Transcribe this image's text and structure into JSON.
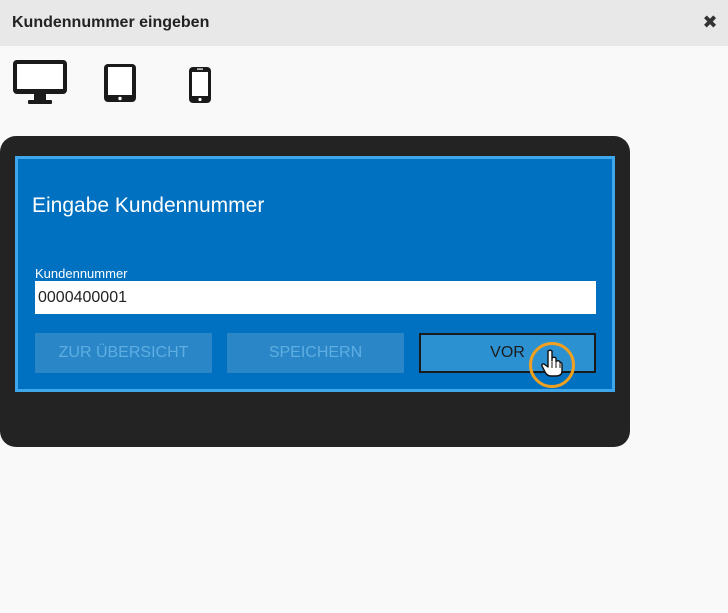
{
  "window": {
    "title": "Kundennummer eingeben",
    "close_icon": "close-icon"
  },
  "device_switcher": {
    "options": [
      {
        "icon": "desktop-icon",
        "selected": true
      },
      {
        "icon": "tablet-icon",
        "selected": false
      },
      {
        "icon": "phone-icon",
        "selected": false
      }
    ]
  },
  "preview": {
    "heading": "Eingabe Kundennummer",
    "field": {
      "label": "Kundennummer",
      "value": "0000400001"
    },
    "buttons": {
      "overview_label": "ZUR ÜBERSICHT",
      "save_label": "SPEICHERN",
      "next_label": "VOR"
    }
  },
  "colors": {
    "screen_bg": "#0070c0",
    "screen_border": "#3ea6ea",
    "frame": "#232323",
    "cursor_highlight": "#f0a020"
  }
}
